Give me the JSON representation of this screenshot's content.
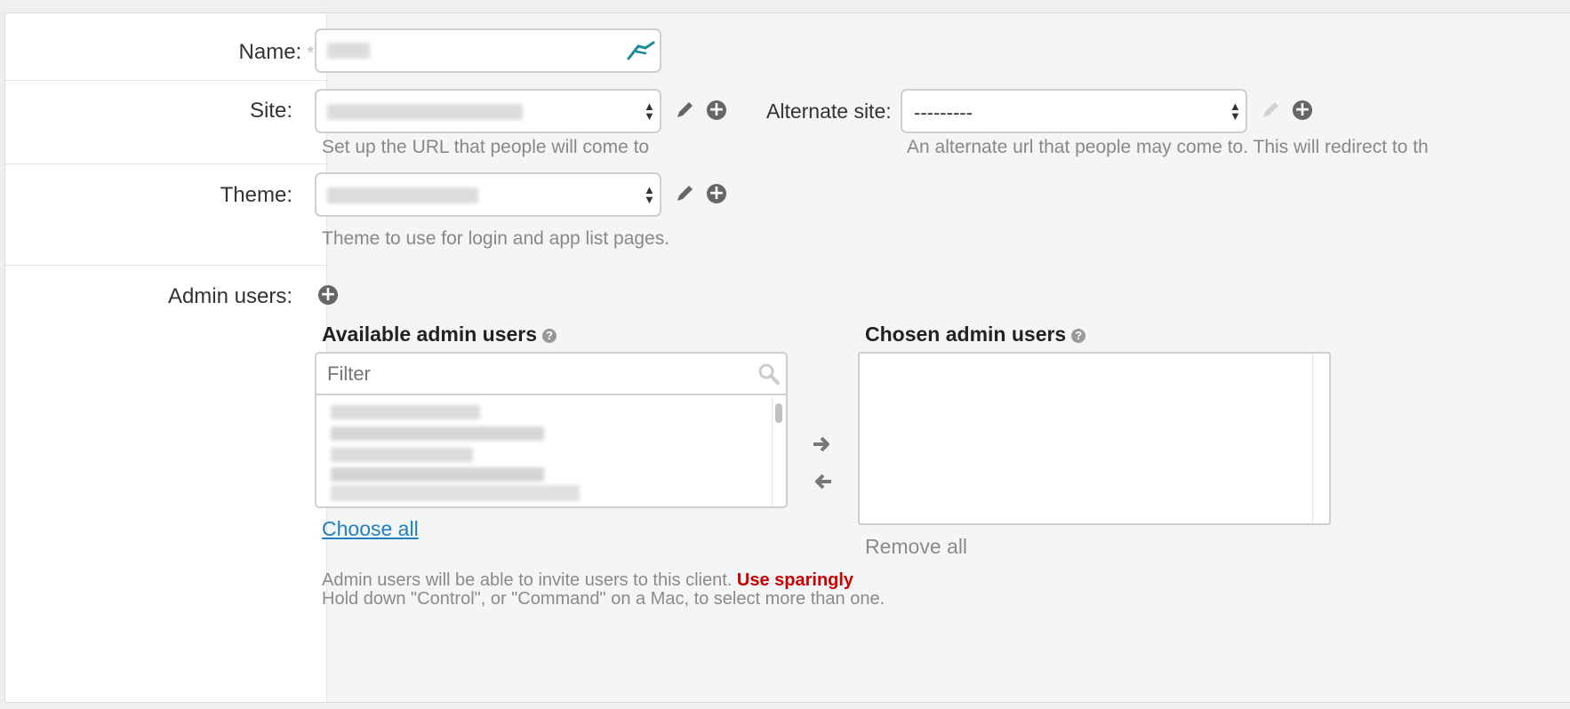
{
  "form": {
    "name": {
      "label": "Name:",
      "required_mark": "*"
    },
    "site": {
      "label": "Site:",
      "help": "Set up the URL that people will come to"
    },
    "alternate_site": {
      "label": "Alternate site:",
      "value": "---------",
      "help": "An alternate url that people may come to. This will redirect to th"
    },
    "theme": {
      "label": "Theme:",
      "help": "Theme to use for login and app list pages."
    },
    "admin_users": {
      "label": "Admin users:",
      "available_heading": "Available admin users",
      "chosen_heading": "Chosen admin users",
      "filter_placeholder": "Filter",
      "choose_all": "Choose all",
      "remove_all": "Remove all",
      "help_prefix": "Admin users will be able to invite users to this client.",
      "help_warning": "Use sparingly",
      "help_line2": "Hold down \"Control\", or \"Command\" on a Mac, to select more than one.",
      "question_mark": "?"
    }
  },
  "icons": {
    "field_icon": "arrow-runner-icon",
    "edit": "pencil-icon",
    "add": "plus-circle-icon",
    "search": "magnifier-icon",
    "move_right": "arrow-right-icon",
    "move_left": "arrow-left-icon"
  },
  "colors": {
    "link": "#1f7fc1",
    "warning": "#cc0000",
    "icon_teal": "#1a8a9a"
  }
}
